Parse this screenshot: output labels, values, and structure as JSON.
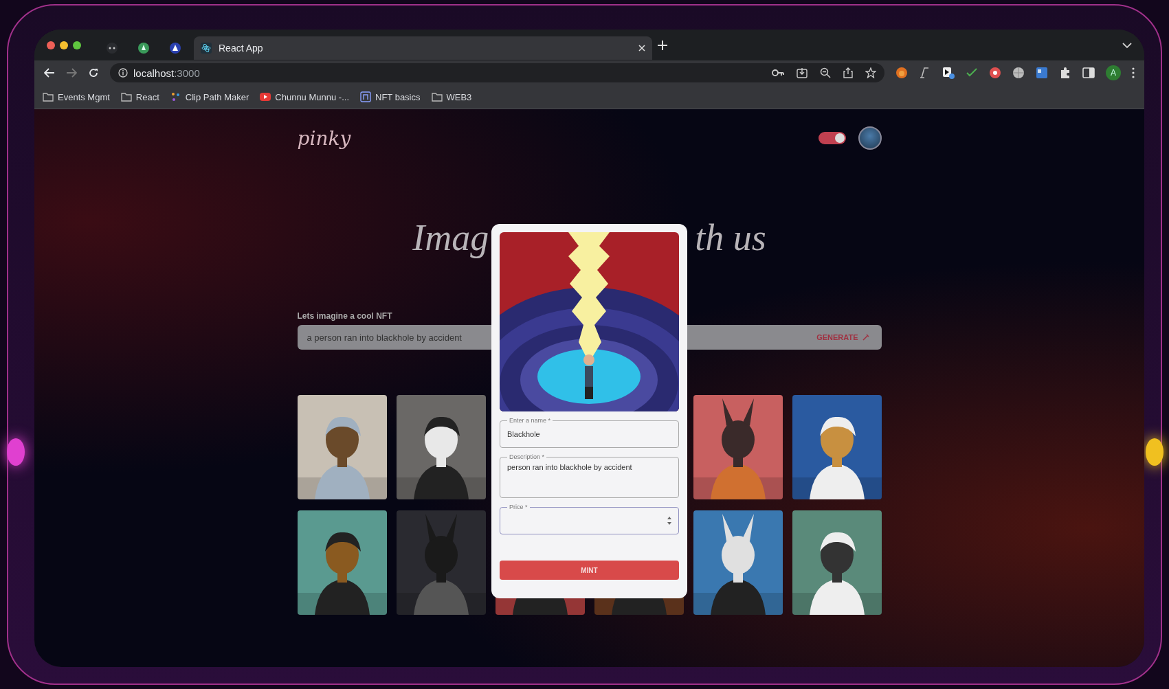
{
  "browser": {
    "tabs": [
      {
        "kind": "pinned",
        "selected": false
      },
      {
        "kind": "pinned",
        "selected": false
      },
      {
        "kind": "pinned",
        "selected": false
      },
      {
        "kind": "page",
        "label": "React App",
        "selected": true
      }
    ],
    "address": {
      "host": "localhost",
      "port": ":3000"
    },
    "bookmarks": [
      {
        "kind": "folder",
        "label": "Events Mgmt"
      },
      {
        "kind": "folder",
        "label": "React"
      },
      {
        "kind": "dots",
        "label": "Clip Path Maker"
      },
      {
        "kind": "video",
        "label": "Chunnu Munnu -..."
      },
      {
        "kind": "site",
        "label": "NFT basics"
      },
      {
        "kind": "folder",
        "label": "WEB3"
      }
    ],
    "profile": "A"
  },
  "page": {
    "logo": "pinky",
    "theme_toggle": {
      "on": true
    },
    "heading_parts": [
      "Imag",
      "th us"
    ],
    "prompt": {
      "label": "Lets imagine a cool NFT",
      "value": "a person ran into blackhole by accident",
      "button": "GENERATE"
    },
    "nft_cards": [
      {
        "kind": "picture"
      },
      {
        "kind": "picture"
      },
      {
        "kind": "picture"
      },
      {
        "kind": "picture"
      },
      {
        "kind": "picture"
      },
      {
        "kind": "picture"
      },
      {
        "kind": "picture"
      },
      {
        "kind": "picture"
      },
      {
        "kind": "picture"
      },
      {
        "kind": "picture"
      }
    ]
  },
  "modal": {
    "image": {
      "kind": "picture"
    },
    "fields": [
      {
        "kind": "text",
        "label": "Enter a name *",
        "value": "Blackhole"
      },
      {
        "kind": "textarea",
        "label": "Description *",
        "value": "person ran into blackhole by accident"
      },
      {
        "kind": "number",
        "label": "Price *"
      }
    ],
    "button": "MINT"
  }
}
